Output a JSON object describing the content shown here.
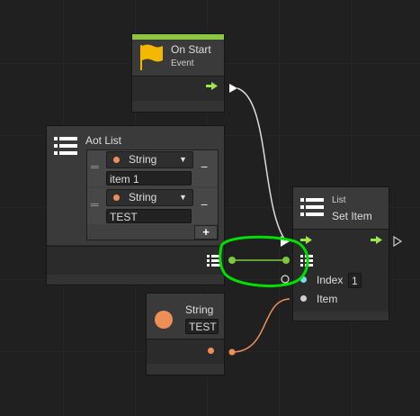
{
  "on_start": {
    "title": "On Start",
    "subtitle": "Event"
  },
  "aot_list": {
    "title": "Aot List",
    "items": [
      {
        "type": "String",
        "value": "item 1"
      },
      {
        "type": "String",
        "value": "TEST"
      }
    ],
    "remove_label": "−",
    "add_label": "+"
  },
  "set_item": {
    "subtitle": "List",
    "title": "Set Item",
    "index_label": "Index",
    "index_value": "1",
    "item_label": "Item"
  },
  "string_node": {
    "title": "String",
    "value": "TEST"
  },
  "colors": {
    "control_flow": "#9ee64a",
    "list_link": "#7ac943",
    "string_port": "#ee8f58",
    "index_port": "#7fd6ef",
    "annotation": "#00e000"
  }
}
